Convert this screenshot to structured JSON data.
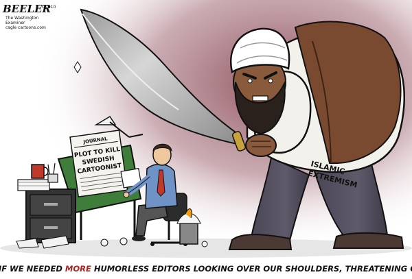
{
  "signature": {
    "name": "BEELER",
    "year": "©2010",
    "publication_line1": "The Washington",
    "publication_line2": "Examiner",
    "site": "cagle cartoons.com"
  },
  "newspaper": {
    "masthead": "JOURNAL",
    "headline_line1": "PLOT TO KILL",
    "headline_line2": "SWEDISH",
    "headline_line3": "CARTOONIST"
  },
  "giant_label": {
    "line1": "ISLAMIC",
    "line2": "EXTREMISM"
  },
  "caption": {
    "prefix": "\"...AS IF WE NEEDED ",
    "emphasis": "MORE",
    "suffix": " HUMORLESS EDITORS LOOKING OVER OUR SHOULDERS, THREATENING CUTS!\""
  },
  "colors": {
    "background_glow": "#8a4a55",
    "sword_blade": "#b8b8b8",
    "vest": "#7a4a30",
    "robe": "#f3f1ec",
    "pants": "#5b5566",
    "drafting_board": "#3f7d3a",
    "cartoonist_shirt": "#6f93c7",
    "file_cabinet": "#333333",
    "mug": "#c0392b",
    "caption_emphasis": "#b11f1f"
  }
}
